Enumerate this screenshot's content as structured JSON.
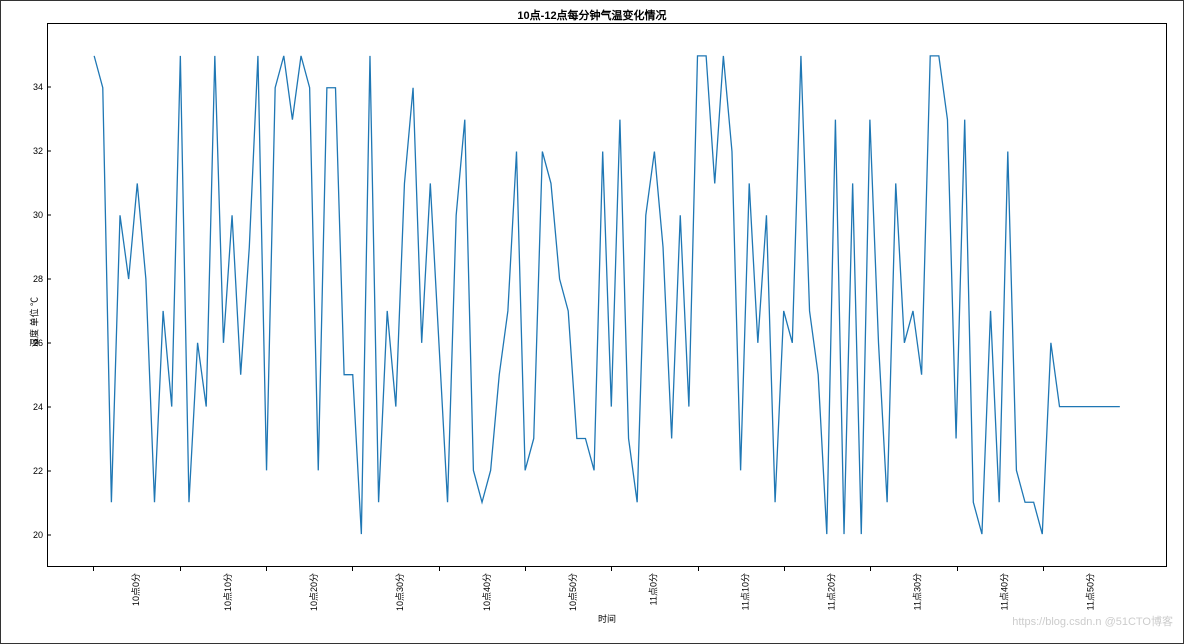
{
  "chart_data": {
    "type": "line",
    "title": "10点-12点每分钟气温变化情况",
    "xlabel": "时间",
    "ylabel": "温度 单位 ℃",
    "ylim": [
      19,
      36
    ],
    "y_ticks": [
      20,
      22,
      24,
      26,
      28,
      30,
      32,
      34
    ],
    "x_tick_labels": [
      "10点0分",
      "10点10分",
      "10点20分",
      "10点30分",
      "10点40分",
      "10点50分",
      "11点0分",
      "11点10分",
      "11点20分",
      "11点30分",
      "11点40分",
      "11点50分"
    ],
    "x_tick_positions": [
      0,
      10,
      20,
      30,
      40,
      50,
      60,
      70,
      80,
      90,
      100,
      110
    ],
    "x_count": 120,
    "values": [
      35,
      34,
      21,
      30,
      28,
      31,
      28,
      21,
      27,
      24,
      35,
      21,
      26,
      24,
      35,
      26,
      30,
      25,
      29,
      35,
      22,
      34,
      35,
      33,
      35,
      34,
      22,
      34,
      34,
      25,
      25,
      20,
      35,
      21,
      27,
      24,
      31,
      34,
      26,
      31,
      26,
      21,
      30,
      33,
      22,
      21,
      22,
      25,
      27,
      32,
      22,
      23,
      32,
      31,
      28,
      27,
      23,
      23,
      22,
      32,
      24,
      33,
      23,
      21,
      30,
      32,
      29,
      23,
      30,
      24,
      35,
      35,
      31,
      35,
      32,
      22,
      31,
      26,
      30,
      21,
      27,
      26,
      35,
      27,
      25,
      20,
      33,
      20,
      31,
      20,
      33,
      26,
      21,
      31,
      26,
      27,
      25,
      35,
      35,
      33,
      23,
      33,
      21,
      20,
      27,
      21,
      32,
      22,
      21,
      21,
      20,
      26,
      24,
      24,
      24,
      24,
      24,
      24,
      24,
      24
    ]
  },
  "watermark": "https://blog.csdn.n @51CTO博客"
}
